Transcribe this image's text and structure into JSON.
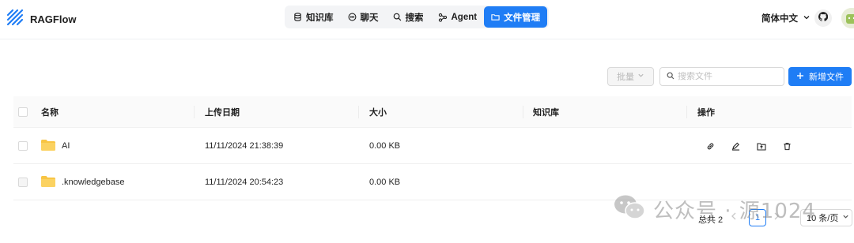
{
  "header": {
    "brand": "RAGFlow",
    "nav": [
      {
        "label": "知识库",
        "icon": "database-icon",
        "active": false
      },
      {
        "label": "聊天",
        "icon": "chat-icon",
        "active": false
      },
      {
        "label": "搜索",
        "icon": "search-icon",
        "active": false
      },
      {
        "label": "Agent",
        "icon": "agent-icon",
        "active": false
      },
      {
        "label": "文件管理",
        "icon": "folder-icon",
        "active": true
      }
    ],
    "language": "简体中文"
  },
  "toolbar": {
    "batch_label": "批量",
    "search_placeholder": "搜索文件",
    "add_label": "新增文件"
  },
  "table": {
    "columns": [
      "名称",
      "上传日期",
      "大小",
      "知识库",
      "操作"
    ],
    "rows": [
      {
        "name": "AI",
        "date": "11/11/2024 21:38:39",
        "size": "0.00 KB",
        "kb": "",
        "has_actions": true
      },
      {
        "name": ".knowledgebase",
        "date": "11/11/2024 20:54:23",
        "size": "0.00 KB",
        "kb": "",
        "has_actions": false
      }
    ]
  },
  "pagination": {
    "total": "总共 2",
    "current_page": "1",
    "page_size": "10 条/页"
  },
  "watermark": "公众号 · 源1024",
  "colors": {
    "accent": "#1f7df5",
    "folder": "#f8c544",
    "border": "#f0f0f0"
  }
}
